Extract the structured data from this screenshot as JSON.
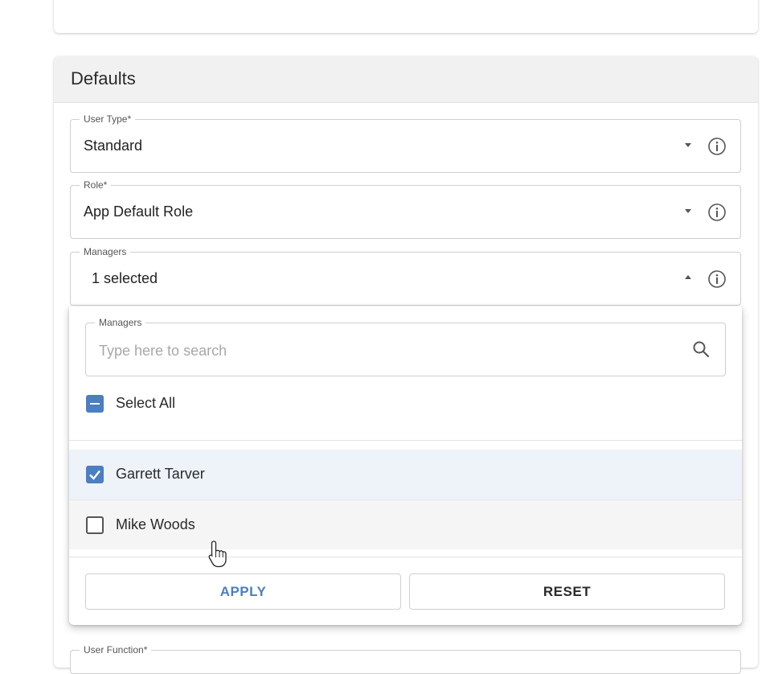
{
  "panel": {
    "title": "Defaults"
  },
  "fields": {
    "user_type": {
      "label": "User Type*",
      "value": "Standard"
    },
    "role": {
      "label": "Role*",
      "value": "App Default Role"
    },
    "managers": {
      "label": "Managers",
      "value": "1 selected"
    },
    "user_function": {
      "label": "User Function*"
    }
  },
  "dropdown": {
    "search_label": "Managers",
    "search_placeholder": "Type here to search",
    "select_all_label": "Select All",
    "options": [
      {
        "label": "Garrett Tarver",
        "checked": true
      },
      {
        "label": "Mike Woods",
        "checked": false
      }
    ],
    "apply_label": "APPLY",
    "reset_label": "RESET"
  },
  "colors": {
    "accent": "#4a7fc1",
    "selected_row": "#eef3f9",
    "header_bg": "#f1f1f1"
  },
  "icons": [
    "info-icon",
    "search-icon",
    "chevron-down-icon",
    "chevron-up-icon",
    "hand-cursor-icon"
  ]
}
